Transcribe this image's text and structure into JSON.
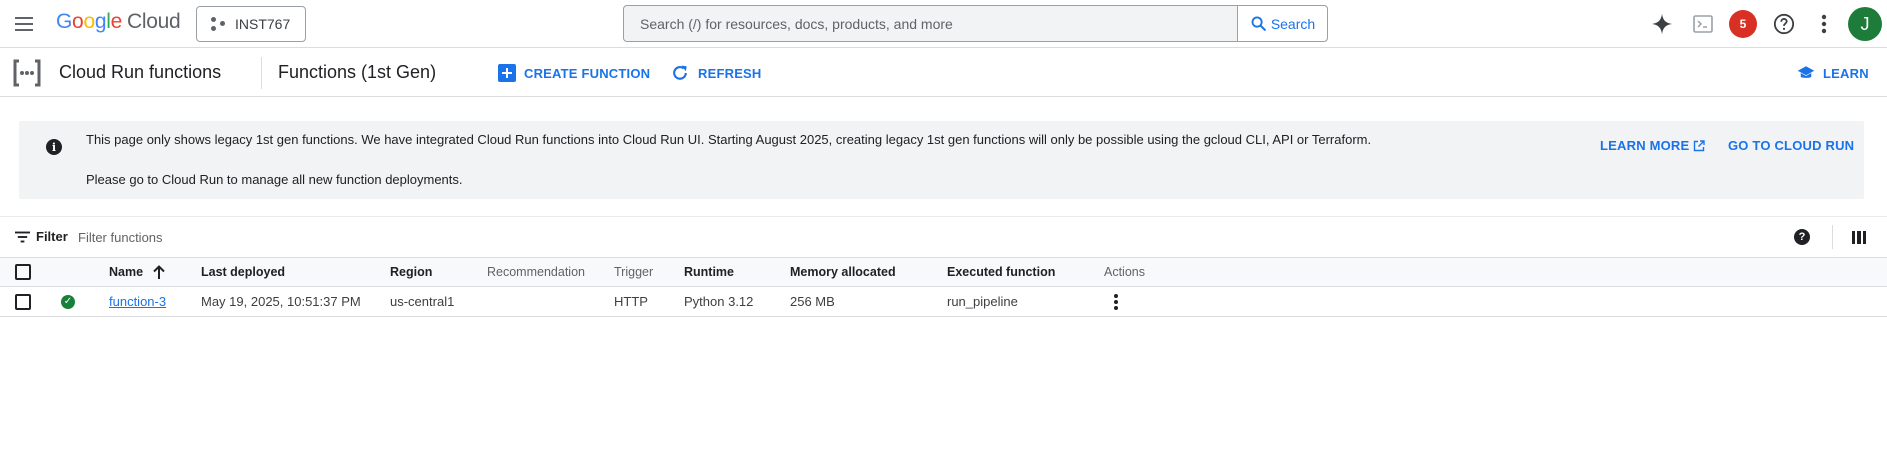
{
  "topbar": {
    "logo": {
      "letters": [
        "G",
        "o",
        "o",
        "g",
        "l",
        "e"
      ],
      "suffix": "Cloud"
    },
    "project": "INST767",
    "search": {
      "placeholder": "Search (/) for resources, docs, products, and more",
      "button_label": "Search"
    },
    "notification_count": "5",
    "avatar_initial": "J",
    "icons": [
      "menu-icon",
      "gemini-sparkle-icon",
      "cloud-shell-icon",
      "notifications-badge",
      "help-icon",
      "more-vert-icon"
    ]
  },
  "subheader": {
    "product_name": "Cloud Run functions",
    "page_title": "Functions (1st Gen)",
    "create_label": "CREATE FUNCTION",
    "refresh_label": "REFRESH",
    "learn_label": "LEARN"
  },
  "banner": {
    "line1": "This page only shows legacy 1st gen functions. We have integrated Cloud Run functions into Cloud Run UI. Starting August 2025, creating legacy 1st gen functions will only be possible using the gcloud CLI, API or Terraform.",
    "line2": "Please go to Cloud Run to manage all new function deployments.",
    "learn_more": "LEARN MORE",
    "go_to_cloud_run": "GO TO CLOUD RUN"
  },
  "filter": {
    "label": "Filter",
    "placeholder": "Filter functions"
  },
  "table": {
    "columns": [
      "Name",
      "Last deployed",
      "Region",
      "Recommendation",
      "Trigger",
      "Runtime",
      "Memory allocated",
      "Executed function",
      "Actions"
    ],
    "sort": "ascending",
    "rows": [
      {
        "status": "ok",
        "name": "function-3",
        "last_deployed": "May 19, 2025, 10:51:37 PM",
        "region": "us-central1",
        "recommendation": "",
        "trigger": "HTTP",
        "runtime": "Python 3.12",
        "memory": "256 MB",
        "executed_function": "run_pipeline"
      }
    ]
  },
  "colors": {
    "accent": "#1a73e8",
    "success": "#188038",
    "badge": "#d93025",
    "avatar": "#1e7c3b",
    "banner_bg": "#f1f3f4"
  }
}
